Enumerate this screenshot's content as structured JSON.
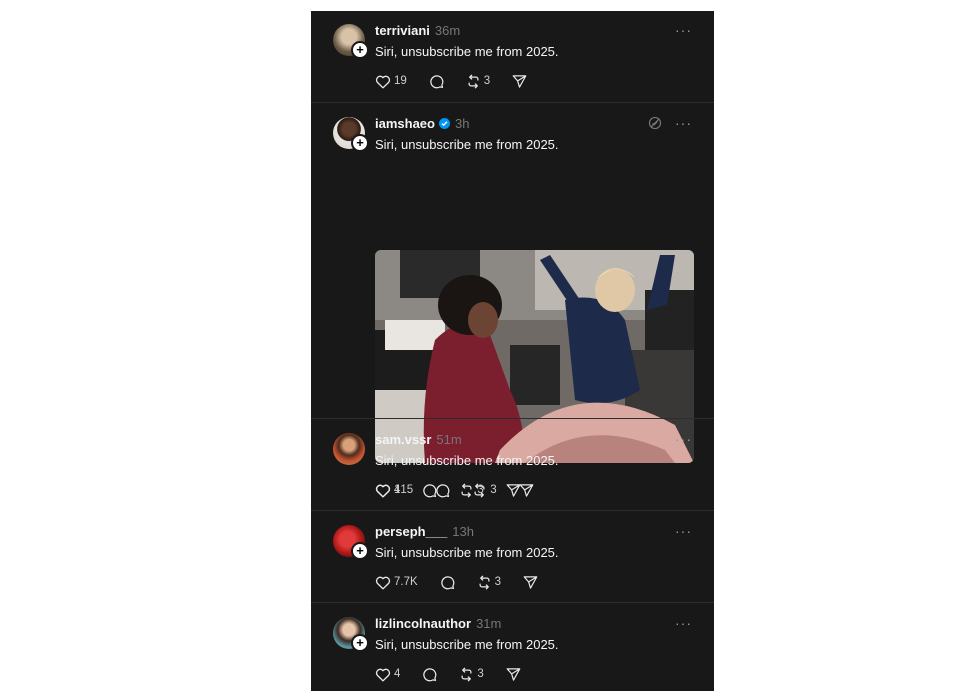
{
  "posts": [
    {
      "username": "terriviani",
      "time": "36m",
      "text": "Siri, unsubscribe me from 2025.",
      "likes": "19",
      "reposts": "3"
    },
    {
      "username": "iamshaeo",
      "time": "3h",
      "text": "Siri, unsubscribe me from 2025.",
      "likes": "415",
      "reposts": "3",
      "verified": true
    },
    {
      "username": "sam.vssr",
      "time": "51m",
      "text": "Siri, unsubscribe me from 2025.",
      "likes": "1",
      "reposts": "3"
    },
    {
      "username": "perseph___",
      "time": "13h",
      "text": "Siri, unsubscribe me from 2025.",
      "likes": "7.7K",
      "reposts": "3"
    },
    {
      "username": "lizlincolnauthor",
      "time": "31m",
      "text": "Siri, unsubscribe me from 2025.",
      "likes": "4",
      "reposts": "3"
    }
  ],
  "more_glyph": "···",
  "follow_glyph": "+",
  "icons": [
    "heart-icon",
    "comment-icon",
    "repost-icon",
    "share-icon",
    "more-icon",
    "verified-badge-icon",
    "cancel-circle-icon"
  ],
  "colors": {
    "background": "#181818",
    "text": "#f3f5f7",
    "secondary": "#777777",
    "verified": "#0095f6"
  }
}
